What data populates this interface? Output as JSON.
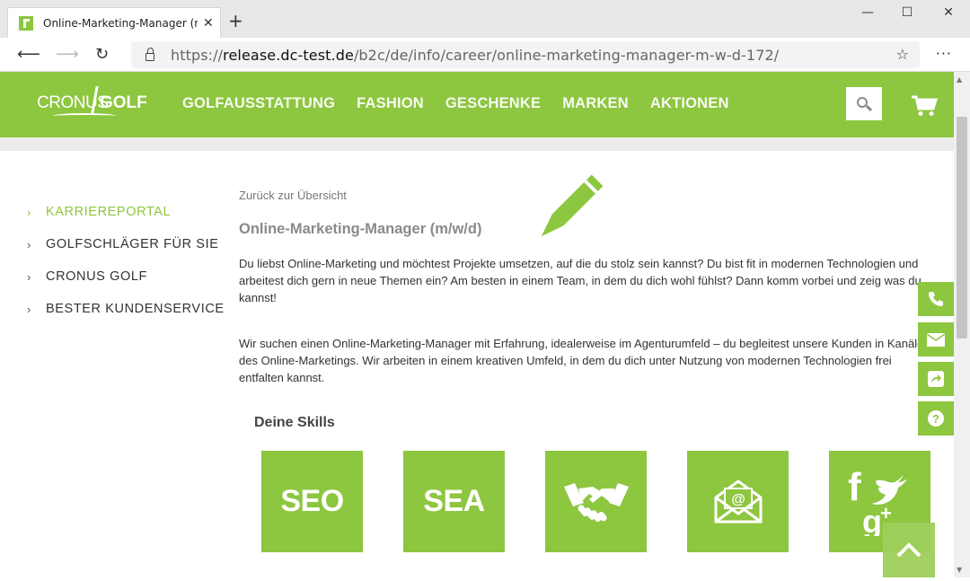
{
  "browser": {
    "tab_title": "Online-Marketing-Manager (m/w/d)",
    "tab_close": "✕",
    "new_tab": "+",
    "url_prefix": "https://",
    "url_host": "release.dc-test.de",
    "url_path": "/b2c/de/info/career/online-marketing-manager-m-w-d-172/",
    "menu": "···",
    "minimize": "—",
    "maximize": "☐",
    "close": "✕"
  },
  "header": {
    "logo_left": "CRONUS",
    "logo_right": "GOLF",
    "nav": [
      "GOLFAUSSTATTUNG",
      "FASHION",
      "GESCHENKE",
      "MARKEN",
      "AKTIONEN"
    ]
  },
  "sidebar": {
    "items": [
      {
        "label": "KARRIEREPORTAL"
      },
      {
        "label": "GOLFSCHLÄGER FÜR SIE"
      },
      {
        "label": "CRONUS GOLF"
      },
      {
        "label": "BESTER KUNDENSERVICE"
      }
    ]
  },
  "content": {
    "back_link": "Zurück zur Übersicht",
    "title": "Online-Marketing-Manager (m/w/d)",
    "para1": "Du liebst Online-Marketing und möchtest Projekte umsetzen, auf die du stolz sein kannst? Du bist fit in modernen Technologien und arbeitest dich gern in neue Themen ein? Am besten in einem Team, in dem du dich wohl fühlst? Dann komm vorbei und zeig was du kannst!",
    "para2": "Wir suchen einen Online-Marketing-Manager mit Erfahrung, idealerweise im Agenturumfeld – du begleitest unsere Kunden in Kanälen des Online-Marketings. Wir arbeiten in einem kreativen Umfeld, in dem du dich unter Nutzung von modernen Technologien frei entfalten kannst.",
    "skills_heading": "Deine Skills",
    "skill_tiles": [
      {
        "label": "SEO",
        "icon": "seo-text"
      },
      {
        "label": "SEA",
        "icon": "sea-text"
      },
      {
        "label": "",
        "icon": "handshake-icon"
      },
      {
        "label": "",
        "icon": "email-envelope-icon"
      },
      {
        "label": "",
        "icon": "social-media-icon"
      }
    ]
  },
  "side_buttons": [
    "phone-icon",
    "mail-icon",
    "share-icon",
    "help-icon"
  ],
  "colors": {
    "brand_green": "#8dc63f",
    "text": "#333333",
    "muted": "#8a8a8a"
  }
}
